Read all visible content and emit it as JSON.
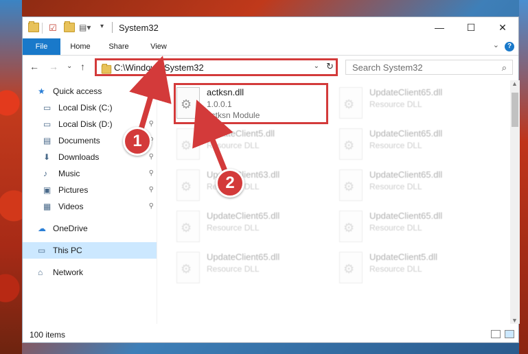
{
  "window": {
    "title": "System32",
    "minimize_glyph": "—",
    "maximize_glyph": "☐",
    "close_glyph": "✕"
  },
  "ribbon": {
    "tabs": [
      "File",
      "Home",
      "Share",
      "View"
    ],
    "expand_glyph": "⌄",
    "help_glyph": "?"
  },
  "nav": {
    "back_glyph": "←",
    "forward_glyph": "→",
    "recent_glyph": "⌄",
    "up_glyph": "↑"
  },
  "address": {
    "path": "C:\\Windows\\System32",
    "dropdown_glyph": "⌄",
    "refresh_glyph": "↻"
  },
  "search": {
    "placeholder": "Search System32",
    "icon_glyph": "⌕"
  },
  "sidebar": {
    "items": [
      {
        "label": "Quick access",
        "icon": "star-icon",
        "glyph": "★",
        "pinned": false
      },
      {
        "label": "Local Disk (C:)",
        "icon": "drive-icon",
        "glyph": "▭",
        "pinned": false
      },
      {
        "label": "Local Disk (D:)",
        "icon": "drive-icon",
        "glyph": "▭",
        "pinned": true
      },
      {
        "label": "Documents",
        "icon": "documents-icon",
        "glyph": "▤",
        "pinned": true
      },
      {
        "label": "Downloads",
        "icon": "download-icon",
        "glyph": "⬇",
        "pinned": true
      },
      {
        "label": "Music",
        "icon": "music-icon",
        "glyph": "♪",
        "pinned": true
      },
      {
        "label": "Pictures",
        "icon": "pictures-icon",
        "glyph": "▣",
        "pinned": true
      },
      {
        "label": "Videos",
        "icon": "videos-icon",
        "glyph": "▦",
        "pinned": true
      },
      {
        "label": "OneDrive",
        "icon": "cloud-icon",
        "glyph": "☁",
        "pinned": false
      },
      {
        "label": "This PC",
        "icon": "computer-icon",
        "glyph": "▭",
        "pinned": false,
        "selected": true
      },
      {
        "label": "Network",
        "icon": "network-icon",
        "glyph": "⌂",
        "pinned": false
      }
    ],
    "pin_glyph": "📌"
  },
  "files": [
    {
      "name": "actksn.dll",
      "line2": "1.0.0.1",
      "line3": "actksn Module",
      "highlighted": true
    },
    {
      "name": "UpdateClient65.dll",
      "line2": "Resource DLL",
      "line3": ""
    },
    {
      "name": "UpdateClient5.dll",
      "line2": "Resource DLL",
      "line3": ""
    },
    {
      "name": "UpdateClient65.dll",
      "line2": "Resource DLL",
      "line3": ""
    },
    {
      "name": "UpdateClient63.dll",
      "line2": "Resource DLL",
      "line3": ""
    },
    {
      "name": "UpdateClient65.dll",
      "line2": "Resource DLL",
      "line3": ""
    },
    {
      "name": "UpdateClient65.dll",
      "line2": "Resource DLL",
      "line3": ""
    },
    {
      "name": "UpdateClient65.dll",
      "line2": "Resource DLL",
      "line3": ""
    },
    {
      "name": "UpdateClient65.dll",
      "line2": "Resource DLL",
      "line3": ""
    },
    {
      "name": "UpdateClient5.dll",
      "line2": "Resource DLL",
      "line3": ""
    }
  ],
  "status": {
    "item_count": "100 items"
  },
  "callouts": [
    "1",
    "2"
  ],
  "colors": {
    "accent": "#1979ca",
    "highlight": "#d33a3a",
    "selected_bg": "#cce8ff"
  }
}
